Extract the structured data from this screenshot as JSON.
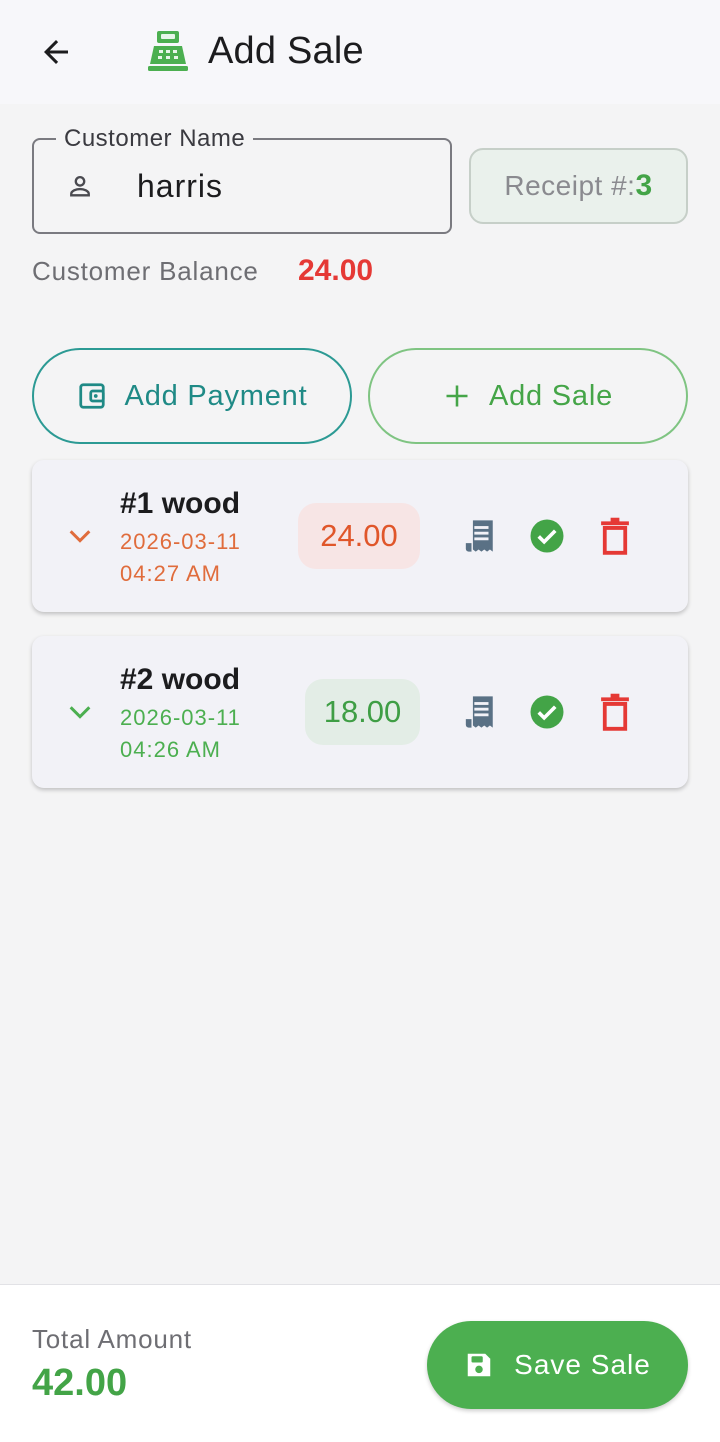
{
  "header": {
    "title": "Add Sale",
    "back_icon": "arrow-left-icon",
    "title_icon": "cash-register-icon"
  },
  "customer": {
    "label": "Customer Name",
    "value": "harris",
    "icon": "person-icon",
    "balance_label": "Customer Balance",
    "balance_value": "24.00"
  },
  "receipt": {
    "label": "Receipt #:",
    "number": "3"
  },
  "actions": {
    "add_payment": "Add Payment",
    "add_sale": "Add Sale"
  },
  "sales": [
    {
      "title": "#1 wood",
      "date": "2026-03-11",
      "time": "04:27 AM",
      "amount": "24.00",
      "status": "unpaid"
    },
    {
      "title": "#2 wood",
      "date": "2026-03-11",
      "time": "04:26 AM",
      "amount": "18.00",
      "status": "paid"
    }
  ],
  "footer": {
    "total_label": "Total Amount",
    "total_value": "42.00",
    "save_label": "Save Sale"
  },
  "colors": {
    "green": "#4caf50",
    "teal": "#1f8a86",
    "red": "#e53935",
    "orange": "#e0562a"
  }
}
